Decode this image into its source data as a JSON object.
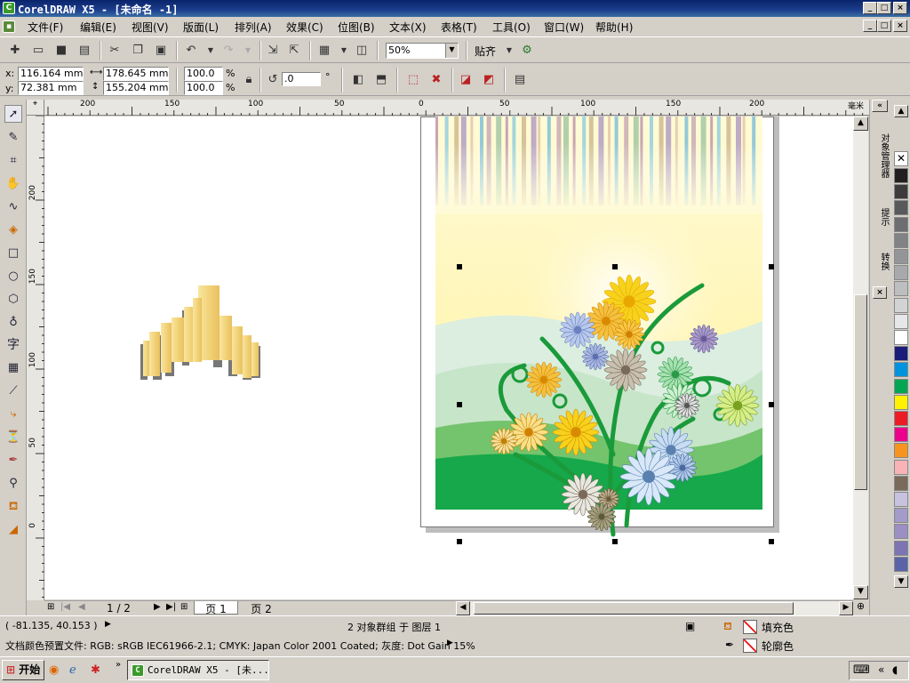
{
  "window": {
    "title": "CorelDRAW X5 - [未命名 -1]"
  },
  "menu": [
    "文件(F)",
    "编辑(E)",
    "视图(V)",
    "版面(L)",
    "排列(A)",
    "效果(C)",
    "位图(B)",
    "文本(X)",
    "表格(T)",
    "工具(O)",
    "窗口(W)",
    "帮助(H)"
  ],
  "toolbar": {
    "zoom": "50%",
    "snap_label": "贴齐"
  },
  "props": {
    "x_label": "x:",
    "x": "116.164 mm",
    "y_label": "y:",
    "y": "72.381 mm",
    "w": "178.645 mm",
    "h": "155.204 mm",
    "scale_w": "100.0",
    "scale_h": "100.0",
    "pct": "%",
    "rotation": ".0",
    "deg": "°"
  },
  "ruler": {
    "unit": "毫米",
    "h_ticks": [
      "200",
      "150",
      "100",
      "50",
      "0",
      "50",
      "100",
      "150",
      "200"
    ],
    "v_ticks": [
      "200",
      "150",
      "100",
      "50",
      "0"
    ]
  },
  "dockers": [
    "对象管理器",
    "提示",
    "转换"
  ],
  "pages": {
    "counter": "1 / 2",
    "tabs": [
      "页 1",
      "页 2"
    ]
  },
  "status": {
    "coords": "( -81.135, 40.153 )",
    "selection": "2 对象群组 于 图层 1",
    "color_profile": "文档颜色预置文件: RGB: sRGB IEC61966-2.1; CMYK: Japan Color 2001 Coated; 灰度: Dot Gain 15%",
    "fill_label": "填充色",
    "outline_label": "轮廓色"
  },
  "taskbar": {
    "start": "开始",
    "task": "CorelDRAW X5 - [未..."
  },
  "palette_colors": [
    "#231f20",
    "#3d3a3b",
    "#58595b",
    "#6d6e71",
    "#808285",
    "#939598",
    "#a7a9ac",
    "#bcbec0",
    "#d1d3d4",
    "#e6e7e8",
    "#ffffff",
    "#1b1b7a",
    "#0093dd",
    "#00a651",
    "#fff200",
    "#ed1c24",
    "#ec008c",
    "#f7941d",
    "#f9b3b7",
    "#7a6a5a",
    "#c7c2e0",
    "#a39bc9",
    "#9b8fc3",
    "#7d74b4",
    "#5b63a8"
  ]
}
